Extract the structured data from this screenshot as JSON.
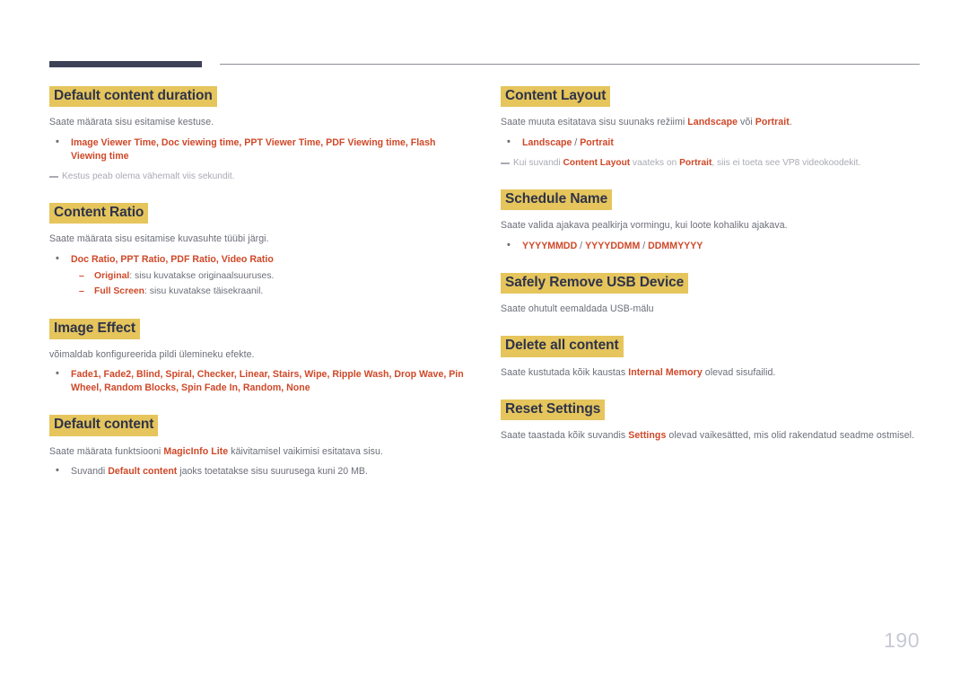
{
  "page": {
    "number": "190",
    "accent_heading_bg": "#e5c55c",
    "accent_heading_text": "#2f3349",
    "accent_keyword": "#cf4828",
    "body_text": "#6c6e79",
    "note_text": "#a9abb4",
    "header_bar": "#3e4257"
  },
  "left_column": {
    "sections": [
      {
        "heading": "Default content duration",
        "body": "Saate määrata sisu esitamise kestuse.",
        "bullets": [
          "Image Viewer Time, Doc viewing time, PPT Viewer Time, PDF Viewing time, Flash Viewing time"
        ],
        "note": "Kestus peab olema vähemalt viis sekundit."
      },
      {
        "heading": "Content Ratio",
        "body": "Saate määrata sisu esitamise kuvasuhte tüübi järgi.",
        "bullets": [
          "Doc Ratio, PPT Ratio, PDF Ratio, Video Ratio"
        ],
        "subbullets": [
          {
            "term": "Original",
            "text": ": sisu kuvatakse originaalsuuruses."
          },
          {
            "term": "Full Screen",
            "text": ": sisu kuvatakse täisekraanil."
          }
        ]
      },
      {
        "heading": "Image Effect",
        "body": "võimaldab konfigureerida pildi ülemineku efekte.",
        "bullets": [
          "Fade1, Fade2, Blind, Spiral, Checker, Linear, Stairs, Wipe, Ripple Wash, Drop Wave, Pin Wheel, Random Blocks, Spin Fade In, Random, None"
        ]
      },
      {
        "heading": "Default content",
        "body_parts": [
          {
            "t": "Saate määrata funktsiooni ",
            "kw": false
          },
          {
            "t": "MagicInfo Lite",
            "kw": true
          },
          {
            "t": " käivitamisel vaikimisi esitatava sisu.",
            "kw": false
          }
        ],
        "bullet_parts": [
          {
            "t": "Suvandi ",
            "kw": false
          },
          {
            "t": "Default content",
            "kw": true
          },
          {
            "t": " jaoks toetatakse sisu suurusega kuni 20 MB.",
            "kw": false
          }
        ]
      }
    ]
  },
  "right_column": {
    "sections": [
      {
        "heading": "Content Layout",
        "body_parts": [
          {
            "t": "Saate muuta esitatava sisu suunaks režiimi ",
            "kw": false
          },
          {
            "t": "Landscape",
            "kw": true
          },
          {
            "t": " või ",
            "kw": false
          },
          {
            "t": "Portrait",
            "kw": true
          },
          {
            "t": ".",
            "kw": false
          }
        ],
        "bullet_parts": [
          {
            "t": "Landscape",
            "kw": true
          },
          {
            "t": " / ",
            "kw": false
          },
          {
            "t": "Portrait",
            "kw": true
          }
        ],
        "note_parts": [
          {
            "t": "Kui suvandi ",
            "kw": false
          },
          {
            "t": "Content Layout",
            "kw": true
          },
          {
            "t": " vaateks on ",
            "kw": false
          },
          {
            "t": "Portrait",
            "kw": true
          },
          {
            "t": ", siis ei toeta see VP8 videokoodekit.",
            "kw": false
          }
        ]
      },
      {
        "heading": "Schedule Name",
        "body": "Saate valida ajakava pealkirja vormingu, kui loote kohaliku ajakava.",
        "bullet_parts": [
          {
            "t": "YYYYMMDD",
            "kw": true
          },
          {
            "t": " / ",
            "kw": false
          },
          {
            "t": "YYYYDDMM",
            "kw": true
          },
          {
            "t": " / ",
            "kw": false
          },
          {
            "t": "DDMMYYYY",
            "kw": true
          }
        ]
      },
      {
        "heading": "Safely Remove USB Device",
        "body": "Saate ohutult eemaldada USB-mälu"
      },
      {
        "heading": "Delete all content",
        "body_parts": [
          {
            "t": "Saate kustutada kõik kaustas ",
            "kw": false
          },
          {
            "t": "Internal Memory",
            "kw": true
          },
          {
            "t": " olevad sisufailid.",
            "kw": false
          }
        ]
      },
      {
        "heading": "Reset Settings",
        "body_parts": [
          {
            "t": "Saate taastada kõik suvandis ",
            "kw": false
          },
          {
            "t": "Settings",
            "kw": true
          },
          {
            "t": " olevad vaikesätted, mis olid rakendatud seadme ostmisel.",
            "kw": false
          }
        ]
      }
    ]
  }
}
